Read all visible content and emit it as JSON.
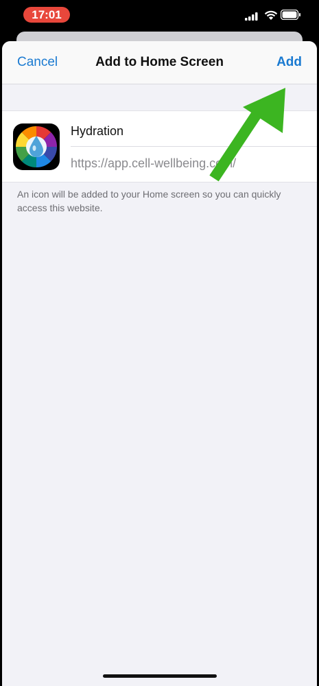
{
  "status_bar": {
    "time": "17:01",
    "time_pill_color": "#e8473b",
    "icons": [
      "signal-icon",
      "wifi-icon",
      "battery-icon"
    ]
  },
  "nav": {
    "cancel_label": "Cancel",
    "title": "Add to Home Screen",
    "add_label": "Add",
    "accent_color": "#1a7ad1"
  },
  "form": {
    "name_value": "Hydration",
    "url": "https://app.cell-wellbeing.com/"
  },
  "hint": "An icon will be added to your Home screen so you can quickly access this website.",
  "annotation": {
    "arrow_color": "#3cb521",
    "arrow_icon": "arrow-up-right-icon"
  }
}
